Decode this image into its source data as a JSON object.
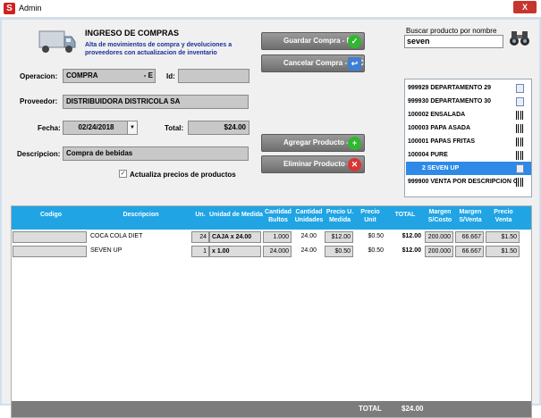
{
  "window": {
    "title": "Admin",
    "close_label": "X"
  },
  "header": {
    "title": "INGRESO DE COMPRAS",
    "subtitle_line1": "Alta de movimientos de compra y devoluciones a",
    "subtitle_line2": "proveedores con actualizacion de inventario"
  },
  "form": {
    "operacion_label": "Operacion:",
    "operacion_value": "COMPRA",
    "operacion_suffix": "- E",
    "id_label": "Id:",
    "id_value": "",
    "proveedor_label": "Proveedor:",
    "proveedor_value": "DISTRIBUIDORA DISTRICOLA  SA",
    "fecha_label": "Fecha:",
    "fecha_value": "02/24/2018",
    "total_label": "Total:",
    "total_value": "$24.00",
    "descripcion_label": "Descripcion:",
    "descripcion_value": "Compra de bebidas",
    "actualiza_label": "Actualiza precios de productos",
    "actualiza_checked": true
  },
  "buttons": {
    "guardar": "Guardar Compra - F4",
    "cancelar": "Cancelar Compra - ESC",
    "agregar": "Agregar Producto - F3",
    "eliminar": "Eliminar Producto - F6"
  },
  "search": {
    "label": "Buscar producto por nombre",
    "value": "seven"
  },
  "product_list": [
    {
      "code": "999929",
      "name": "DEPARTAMENTO 29",
      "icon": "document-icon",
      "selected": false
    },
    {
      "code": "999930",
      "name": "DEPARTAMENTO 30",
      "icon": "document-icon",
      "selected": false
    },
    {
      "code": "100002",
      "name": "ENSALADA",
      "icon": "barcode-icon",
      "selected": false
    },
    {
      "code": "100003",
      "name": "PAPA ASADA",
      "icon": "barcode-icon",
      "selected": false
    },
    {
      "code": "100001",
      "name": "PAPAS FRITAS",
      "icon": "barcode-icon",
      "selected": false
    },
    {
      "code": "100004",
      "name": "PURE",
      "icon": "barcode-icon",
      "selected": false
    },
    {
      "code": "2",
      "name": "SEVEN UP",
      "icon": "document-icon",
      "selected": true
    },
    {
      "code": "999900",
      "name": "VENTA POR DESCRIPCION G",
      "icon": "barcode-icon",
      "selected": false
    }
  ],
  "grid": {
    "headers": {
      "codigo": "Codigo",
      "descripcion": "Descripcion",
      "un": "Un.",
      "unidad_medida": "Unidad de Medida",
      "cantidad_bultos": [
        "Cantidad",
        "Bultos"
      ],
      "cantidad_unidades": [
        "Cantidad",
        "Unidades"
      ],
      "precio_u_medida": [
        "Precio U.",
        "Medida"
      ],
      "precio_unit": [
        "Precio",
        "Unit"
      ],
      "total": "TOTAL",
      "margen_costo": [
        "Margen",
        "S/Costo"
      ],
      "margen_venta": [
        "Margen",
        "S/Venta"
      ],
      "precio_venta": [
        "Precio",
        "Venta"
      ]
    },
    "rows": [
      {
        "codigo": "",
        "descripcion": "COCA COLA DIET",
        "un": "24",
        "unidad_medida": "CAJA x 24.00",
        "bultos": "1.000",
        "unidades": "24.00",
        "precio_um": "$12.00",
        "precio_unit": "$0.50",
        "total": "$12.00",
        "margen_costo": "200.000",
        "margen_venta": "66.667",
        "precio_venta": "$1.50"
      },
      {
        "codigo": "",
        "descripcion": "SEVEN UP",
        "un": "1",
        "unidad_medida": "x 1.00",
        "bultos": "24.000",
        "unidades": "24.00",
        "precio_um": "$0.50",
        "precio_unit": "$0.50",
        "total": "$12.00",
        "margen_costo": "200.000",
        "margen_venta": "66.667",
        "precio_venta": "$1.50"
      }
    ],
    "footer_label": "TOTAL",
    "footer_value": "$24.00"
  },
  "colors": {
    "grid_header": "#20a4e4",
    "selected_row": "#2e8ae6",
    "button": "#7f7f7f",
    "save_icon": "#2fb82f",
    "delete_icon": "#d93434"
  }
}
